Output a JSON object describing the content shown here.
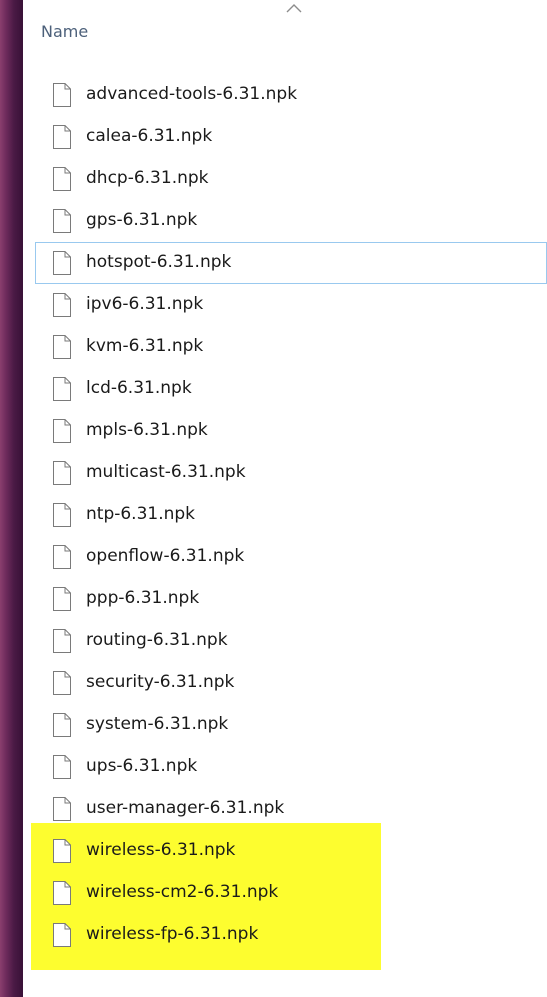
{
  "column_header": {
    "label": "Name"
  },
  "colors": {
    "highlight": "#fdfd2f",
    "focus_border": "#99c9ef",
    "header_text": "#4c607a"
  },
  "icons": {
    "sort_indicator": "chevron-up-icon",
    "file": "file-icon"
  },
  "files": [
    {
      "name": "advanced-tools-6.31.npk"
    },
    {
      "name": "calea-6.31.npk"
    },
    {
      "name": "dhcp-6.31.npk"
    },
    {
      "name": "gps-6.31.npk"
    },
    {
      "name": "hotspot-6.31.npk",
      "focused": true
    },
    {
      "name": "ipv6-6.31.npk"
    },
    {
      "name": "kvm-6.31.npk"
    },
    {
      "name": "lcd-6.31.npk"
    },
    {
      "name": "mpls-6.31.npk"
    },
    {
      "name": "multicast-6.31.npk"
    },
    {
      "name": "ntp-6.31.npk"
    },
    {
      "name": "openflow-6.31.npk"
    },
    {
      "name": "ppp-6.31.npk"
    },
    {
      "name": "routing-6.31.npk"
    },
    {
      "name": "security-6.31.npk"
    },
    {
      "name": "system-6.31.npk"
    },
    {
      "name": "ups-6.31.npk"
    },
    {
      "name": "user-manager-6.31.npk"
    },
    {
      "name": "wireless-6.31.npk",
      "highlighted": true
    },
    {
      "name": "wireless-cm2-6.31.npk",
      "highlighted": true
    },
    {
      "name": "wireless-fp-6.31.npk",
      "highlighted": true
    }
  ]
}
